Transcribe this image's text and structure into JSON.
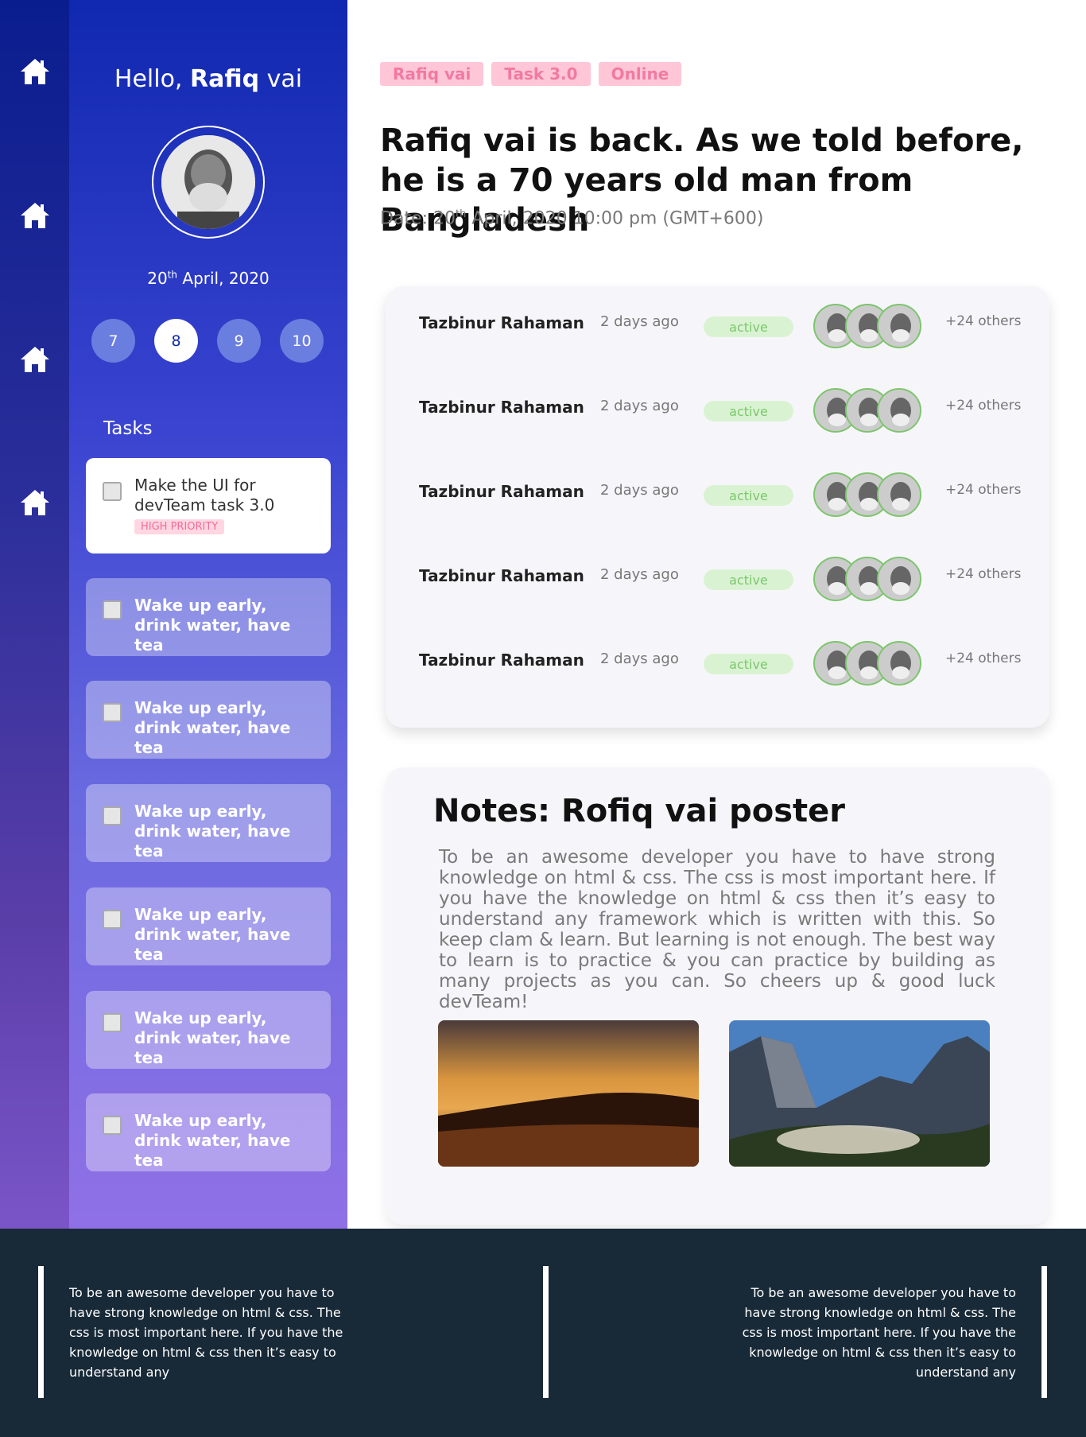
{
  "sidebar": {
    "greeting_prefix": "Hello,",
    "greeting_name": "Rafiq",
    "greeting_suffix": "vai",
    "date_day": "20",
    "date_sup": "th",
    "date_rest": "April, 2020",
    "days": [
      "7",
      "8",
      "9",
      "10"
    ],
    "active_day": "8",
    "tasks_label": "Tasks",
    "tasks": [
      {
        "text": "Make the UI for devTeam task 3.0",
        "priority": "HIGH PRIORITY"
      },
      {
        "text": "Wake up early, drink water, have tea"
      },
      {
        "text": "Wake up early, drink water, have tea"
      },
      {
        "text": "Wake up early, drink water, have tea"
      },
      {
        "text": "Wake up early, drink water, have tea"
      },
      {
        "text": "Wake up early, drink water, have tea"
      },
      {
        "text": "Wake up early, drink water, have tea"
      }
    ]
  },
  "main": {
    "tags": [
      "Rafiq vai",
      "Task 3.0",
      "Online"
    ],
    "title": "Rafiq vai is back. As we told before, he is a 70 years old man from Bangladesh",
    "date_prefix": "Date: 20",
    "date_sup": "th",
    "date_rest": " April, 2020 10:00 pm (GMT+600)",
    "rows": [
      {
        "name": "Tazbinur Rahaman",
        "ago": "2 days ago",
        "status": "active",
        "others": "+24 others"
      },
      {
        "name": "Tazbinur Rahaman",
        "ago": "2 days ago",
        "status": "active",
        "others": "+24 others"
      },
      {
        "name": "Tazbinur Rahaman",
        "ago": "2 days ago",
        "status": "active",
        "others": "+24 others"
      },
      {
        "name": "Tazbinur Rahaman",
        "ago": "2 days ago",
        "status": "active",
        "others": "+24 others"
      },
      {
        "name": "Tazbinur Rahaman",
        "ago": "2 days ago",
        "status": "active",
        "others": "+24 others"
      }
    ],
    "notes_title": "Notes: Rofiq vai poster",
    "notes_text": "To be an awesome developer you have to have strong knowledge on html & css. The css is most important here. If you have the knowledge on html & css then it’s easy to understand any framework which is written with this. So keep clam & learn. But learning is not enough. The best way to learn is to practice & you can practice by building as many projects as you can. So cheers up & good luck devTeam!"
  },
  "footer": {
    "left": "To be an awesome developer you have to have strong knowledge on html & css. The css is most important here. If you have the knowledge on html & css then it’s easy to understand any",
    "right": "To be an awesome developer you have to have strong knowledge on html & css. The css is most important here. If you have the knowledge on html & css then it’s easy to understand any"
  },
  "colors": {
    "accent": "#1028b0",
    "tag": "#f27aa2",
    "status": "#7cc66c",
    "footer": "#182937"
  }
}
